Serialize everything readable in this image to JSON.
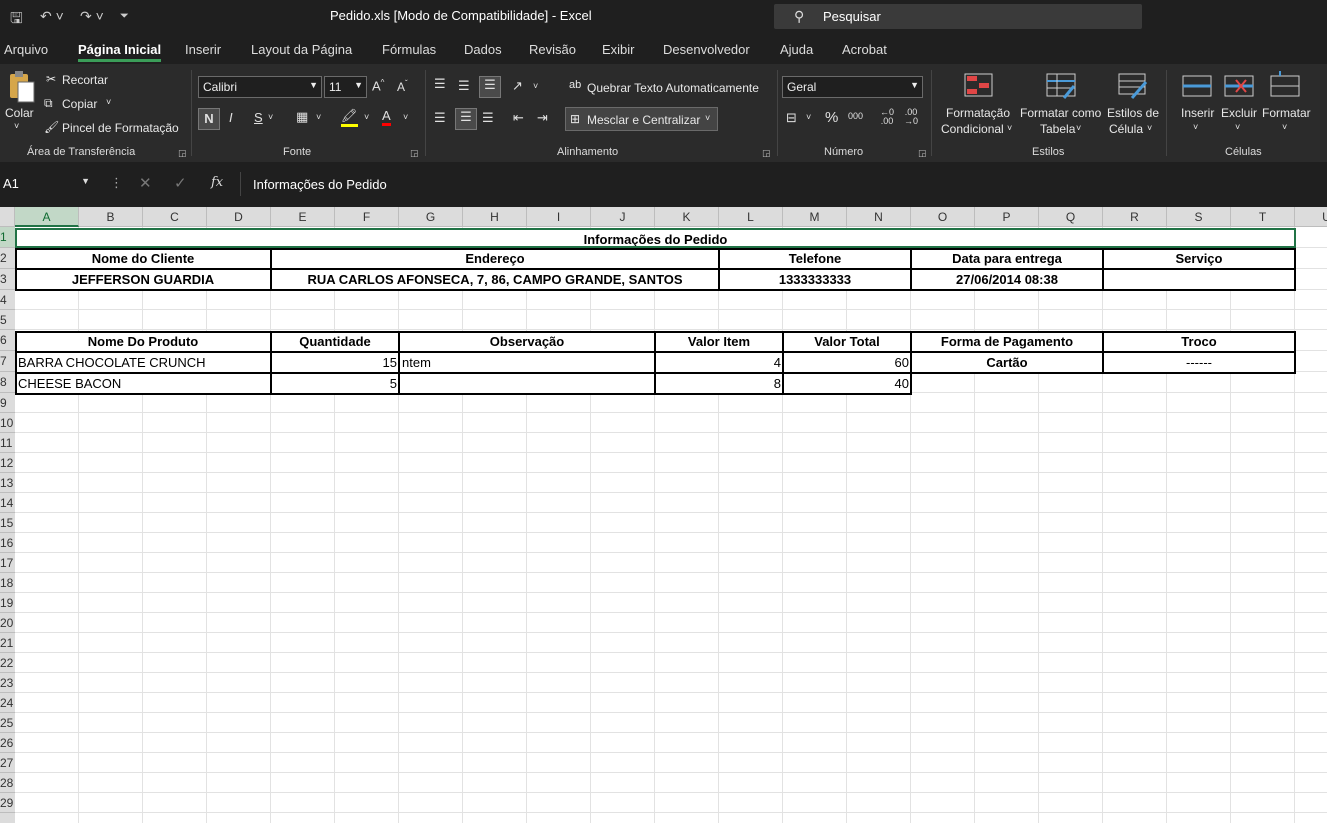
{
  "window": {
    "title": "Pedido.xls  [Modo de Compatibilidade]  -  Excel",
    "search_placeholder": "Pesquisar"
  },
  "menu": {
    "tabs": [
      "Arquivo",
      "Página Inicial",
      "Inserir",
      "Layout da Página",
      "Fórmulas",
      "Dados",
      "Revisão",
      "Exibir",
      "Desenvolvedor",
      "Ajuda",
      "Acrobat"
    ],
    "active_tab": "Página Inicial"
  },
  "ribbon": {
    "clipboard": {
      "paste_label": "Colar",
      "cut_label": "Recortar",
      "copy_label": "Copiar",
      "format_painter_label": "Pincel de Formatação",
      "group_title": "Área de Transferência"
    },
    "font": {
      "font_name": "Calibri",
      "font_size": "11",
      "bold_label": "N",
      "italic_label": "I",
      "underline_label": "S",
      "group_title": "Fonte"
    },
    "alignment": {
      "wrap_label": "Quebrar Texto Automaticamente",
      "merge_label": "Mesclar e Centralizar",
      "group_title": "Alinhamento"
    },
    "number": {
      "format": "Geral",
      "group_title": "Número"
    },
    "styles": {
      "conditional_line1": "Formatação",
      "conditional_line2": "Condicional",
      "table_line1": "Formatar como",
      "table_line2": "Tabela",
      "cell_styles_line1": "Estilos de",
      "cell_styles_line2": "Célula",
      "group_title": "Estilos"
    },
    "cells": {
      "insert_label": "Inserir",
      "delete_label": "Excluir",
      "format_label": "Formatar",
      "group_title": "Células"
    }
  },
  "formula_bar": {
    "name_box": "A1",
    "content": "Informações do Pedido"
  },
  "sheet": {
    "columns": [
      "A",
      "B",
      "C",
      "D",
      "E",
      "F",
      "G",
      "H",
      "I",
      "J",
      "K",
      "L",
      "M",
      "N",
      "O",
      "P",
      "Q",
      "R",
      "S",
      "T",
      "U"
    ],
    "rows": [
      "1",
      "2",
      "3",
      "4",
      "5",
      "6",
      "7",
      "8",
      "9",
      "10",
      "11",
      "12",
      "13",
      "14",
      "15",
      "16",
      "17",
      "18",
      "19",
      "20",
      "21",
      "22",
      "23",
      "24",
      "25",
      "26",
      "27",
      "28",
      "29"
    ],
    "title": "Informações do Pedido",
    "order_header": {
      "cliente": "Nome do Cliente",
      "endereco": "Endereço",
      "telefone": "Telefone",
      "entrega": "Data para entrega",
      "servico": "Serviço"
    },
    "order_values": {
      "cliente": "JEFFERSON GUARDIA",
      "endereco": "RUA CARLOS AFONSECA, 7, 86, CAMPO GRANDE, SANTOS",
      "telefone": "1333333333",
      "entrega": "27/06/2014 08:38",
      "servico": ""
    },
    "items_header": {
      "produto": "Nome Do Produto",
      "quantidade": "Quantidade",
      "observacao": "Observação",
      "valor_item": "Valor Item",
      "valor_total": "Valor Total",
      "pagamento": "Forma de Pagamento",
      "troco": "Troco"
    },
    "items": [
      {
        "produto": "BARRA CHOCOLATE CRUNCH",
        "quantidade": "15",
        "observacao": "ntem",
        "valor_item": "4",
        "valor_total": "60",
        "pagamento": "Cartão",
        "troco": "------"
      },
      {
        "produto": "CHEESE BACON",
        "quantidade": "5",
        "observacao": "",
        "valor_item": "8",
        "valor_total": "40"
      }
    ]
  }
}
